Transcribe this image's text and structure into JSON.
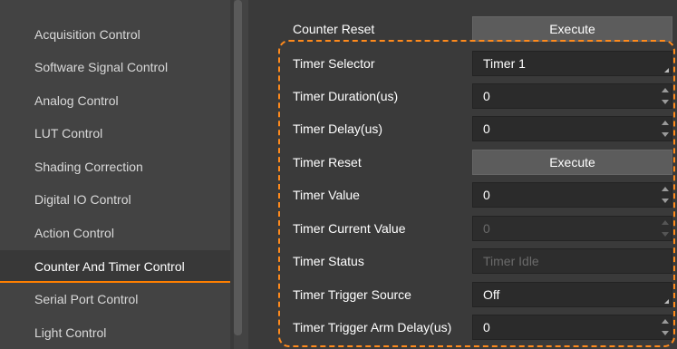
{
  "sidebar": {
    "items": [
      {
        "label": "Acquisition Control"
      },
      {
        "label": "Software Signal Control"
      },
      {
        "label": "Analog Control"
      },
      {
        "label": "LUT Control"
      },
      {
        "label": "Shading Correction"
      },
      {
        "label": "Digital IO Control"
      },
      {
        "label": "Action Control"
      },
      {
        "label": "Counter And Timer Control"
      },
      {
        "label": "Serial Port Control"
      },
      {
        "label": "Light Control"
      }
    ],
    "selected": "Counter And Timer Control"
  },
  "properties": [
    {
      "label": "Counter Reset",
      "type": "button",
      "value": "Execute"
    },
    {
      "label": "Timer Selector",
      "type": "dropdown",
      "value": "Timer 1"
    },
    {
      "label": "Timer Duration(us)",
      "type": "spin",
      "value": "0"
    },
    {
      "label": "Timer Delay(us)",
      "type": "spin",
      "value": "0"
    },
    {
      "label": "Timer Reset",
      "type": "button",
      "value": "Execute"
    },
    {
      "label": "Timer Value",
      "type": "spin",
      "value": "0"
    },
    {
      "label": "Timer Current Value",
      "type": "spin-disabled",
      "value": "0"
    },
    {
      "label": "Timer Status",
      "type": "text-disabled",
      "value": "Timer Idle"
    },
    {
      "label": "Timer Trigger Source",
      "type": "dropdown",
      "value": "Off"
    },
    {
      "label": "Timer Trigger Arm Delay(us)",
      "type": "spin",
      "value": "0"
    }
  ],
  "colors": {
    "accent": "#ff7f00",
    "highlight_border": "#ff8a1c",
    "background": "#434343"
  }
}
